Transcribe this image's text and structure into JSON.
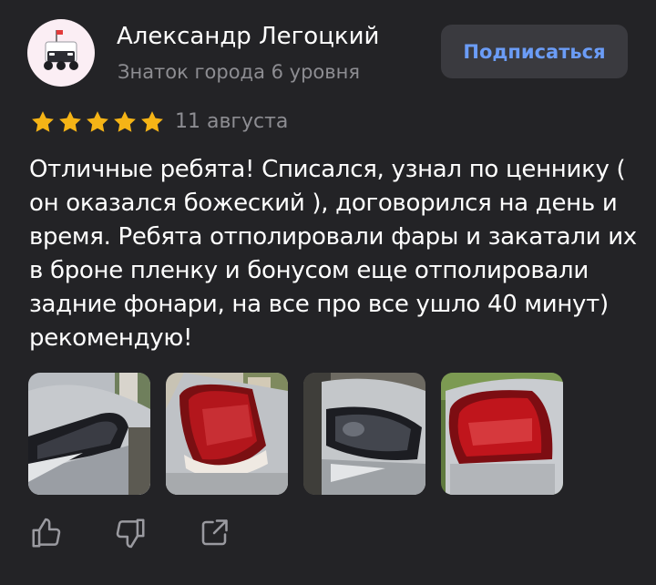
{
  "author": {
    "name": "Александр Легоцкий",
    "level": "Знаток города 6 уровня",
    "avatar_icon": "delivery-robot-icon"
  },
  "subscribe": {
    "label": "Подписаться"
  },
  "rating": {
    "value": 5,
    "max": 5,
    "date": "11 августа"
  },
  "review": {
    "text": "Отличные ребята! Списался, узнал по ценнику ( он оказался божеский ), договорился на день и время. Ребята отполировали фары и закатали их в броне пленку и бонусом еще отполировали задние фонари, на все про все ушло 40 минут) рекомендую!"
  },
  "photos": [
    {
      "subject": "front-headlight"
    },
    {
      "subject": "tail-light"
    },
    {
      "subject": "front-headlight"
    },
    {
      "subject": "tail-light"
    }
  ],
  "actions": [
    {
      "icon": "thumbs-up-icon"
    },
    {
      "icon": "thumbs-down-icon"
    },
    {
      "icon": "share-icon"
    }
  ],
  "colors": {
    "background": "#232326",
    "accent": "#6b9cf6",
    "star": "#f5b416",
    "muted_text": "#8d8d92",
    "button_bg": "#3a3a3f"
  }
}
